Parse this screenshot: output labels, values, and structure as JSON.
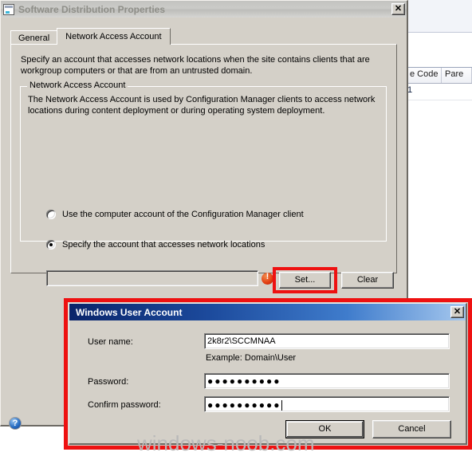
{
  "background": {
    "table": {
      "headers": [
        "e Code",
        "Pare"
      ],
      "rows": [
        [
          "1",
          ""
        ]
      ]
    }
  },
  "properties_dialog": {
    "title": "Software Distribution Properties",
    "icon": "window-properties-icon",
    "close_label": "✕",
    "tabs": [
      {
        "label": "General",
        "active": false
      },
      {
        "label": "Network Access Account",
        "active": true
      }
    ],
    "page_description": "Specify an account that accesses network locations when the site contains clients that are workgroup computers or that are from an untrusted domain.",
    "group": {
      "legend": "Network Access Account",
      "description": "The Network Access Account is used by Configuration Manager clients to access network locations during content deployment or during operating system deployment.",
      "radios": [
        {
          "label": "Use the computer account of the Configuration Manager client",
          "checked": false
        },
        {
          "label": "Specify the account that accesses network locations",
          "checked": true
        }
      ],
      "account_value": "",
      "error_icon": "error-exclamation-icon",
      "set_label": "Set...",
      "clear_label": "Clear"
    },
    "help_icon": "help-question-icon"
  },
  "user_account_dialog": {
    "title": "Windows User Account",
    "close_label": "✕",
    "username_label": "User name:",
    "username_value": "2k8r2\\SCCMNAA",
    "example_text": "Example: Domain\\User",
    "password_label": "Password:",
    "password_value": "●●●●●●●●●●",
    "confirm_label": "Confirm password:",
    "confirm_value": "●●●●●●●●●●",
    "ok_label": "OK",
    "cancel_label": "Cancel"
  },
  "watermark": "windows-noob.com",
  "colors": {
    "highlight_red": "#ee1111",
    "dialog_face": "#d4d0c8",
    "active_title_blue": "#0a246a"
  }
}
